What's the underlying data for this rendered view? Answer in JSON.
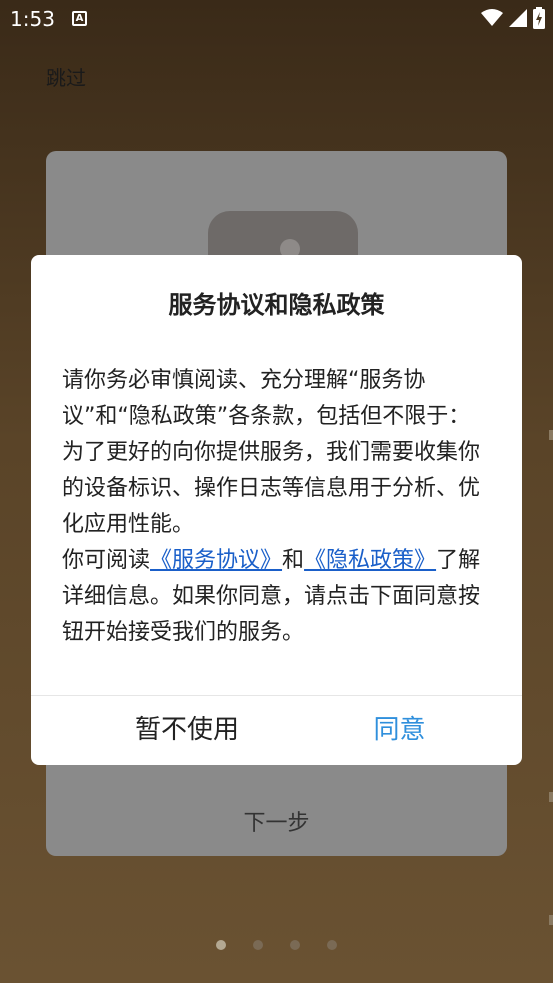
{
  "status_bar": {
    "time": "1:53",
    "notification_icon": "A"
  },
  "onboarding": {
    "skip_label": "跳过",
    "next_label": "下一步",
    "page_count": 4,
    "active_page": 1
  },
  "dialog": {
    "title": "服务协议和隐私政策",
    "body_intro": "请你务必审慎阅读、充分理解“服务协议”和“隐私政策”各条款，包括但不限于：为了更好的向你提供服务，我们需要收集你的设备标识、操作日志等信息用于分析、优化应用性能。",
    "body_prefix": "你可阅读",
    "link_service": "《服务协议》",
    "body_and": "和",
    "link_privacy": "《隐私政策》",
    "body_suffix": "了解详细信息。如果你同意，请点击下面同意按钮开始接受我们的服务。",
    "decline_label": "暂不使用",
    "agree_label": "同意",
    "link_color": "#1a5fc9",
    "agree_color": "#2f8fdc"
  }
}
